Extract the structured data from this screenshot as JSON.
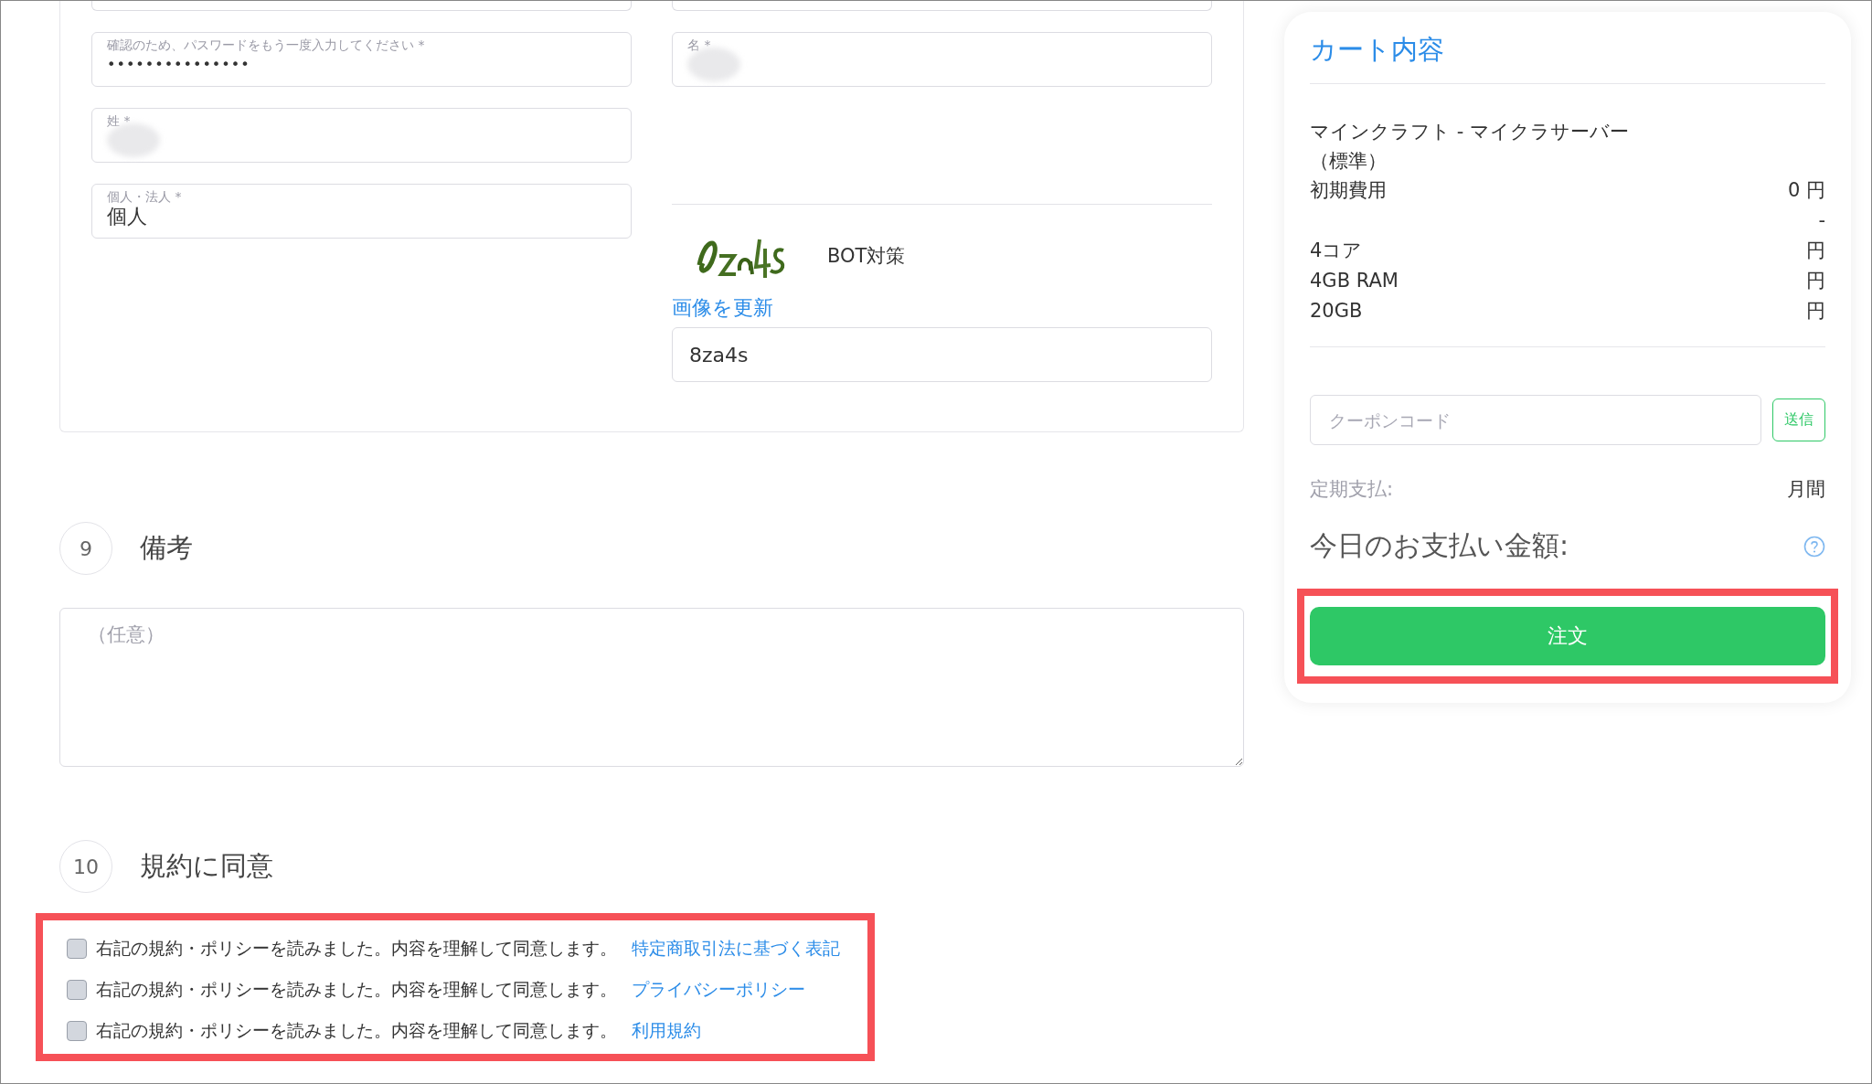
{
  "account_form": {
    "left_fields": [
      {
        "label": "確認のため、パスワードをもう一度入力してください *",
        "kind": "password",
        "value": "•••••••••••••••"
      },
      {
        "label": "姓 *",
        "kind": "redacted"
      },
      {
        "label": "個人・法人 *",
        "kind": "text",
        "value": "個人"
      }
    ],
    "right_fields": [
      {
        "label": "名 *",
        "kind": "redacted"
      }
    ],
    "captcha": {
      "label": "BOT対策",
      "refresh_link": "画像を更新",
      "value": "8za4s"
    }
  },
  "sections": [
    {
      "number": "9",
      "title": "備考",
      "kind": "notes",
      "placeholder": "（任意）"
    },
    {
      "number": "10",
      "title": "規約に同意",
      "kind": "agreements",
      "highlighted": true,
      "items": [
        {
          "text": "右記の規約・ポリシーを読みました。内容を理解して同意します。",
          "link": "特定商取引法に基づく表記",
          "checked": false
        },
        {
          "text": "右記の規約・ポリシーを読みました。内容を理解して同意します。",
          "link": "プライバシーポリシー",
          "checked": false
        },
        {
          "text": "右記の規約・ポリシーを読みました。内容を理解して同意します。",
          "link": "利用規約",
          "checked": false
        }
      ]
    }
  ],
  "cart": {
    "title": "カート内容",
    "product": "マインクラフト - マイクラサーバー",
    "plan": "（標準）",
    "rows": [
      {
        "label": "初期費用",
        "value": "0 円"
      },
      {
        "value": "-"
      },
      {
        "label": "4コア",
        "value": "円"
      },
      {
        "label": "4GB RAM",
        "value": "円"
      },
      {
        "label": "20GB",
        "value": "円"
      }
    ],
    "coupon": {
      "placeholder": "クーポンコード",
      "button": "送信"
    },
    "recurring": {
      "label": "定期支払:",
      "value": "月間"
    },
    "today": {
      "label": "今日のお支払い金額:"
    },
    "order_button": {
      "label": "注文",
      "highlighted": true
    }
  }
}
